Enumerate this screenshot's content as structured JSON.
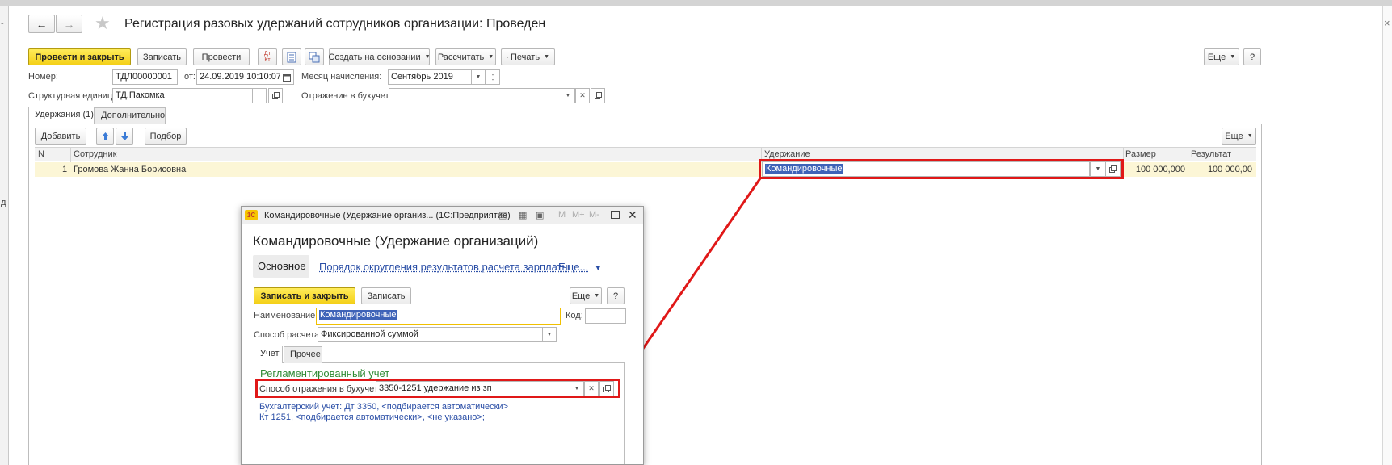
{
  "window": {
    "title": "Регистрация разовых удержаний сотрудников организации: Проведен",
    "close_glyph": "×",
    "back_glyph": "←",
    "forward_glyph": "→",
    "star_glyph": "★"
  },
  "left_panel": {
    "chars": [
      "-",
      "д"
    ]
  },
  "toolbar": {
    "post_close": "Провести и закрыть",
    "save": "Записать",
    "post": "Провести",
    "dtkt": "Дт Кт",
    "create_based": "Создать на основании",
    "calculate": "Рассчитать",
    "print": "Печать",
    "more": "Еще",
    "help": "?"
  },
  "fields": {
    "number_label": "Номер:",
    "number_value": "ТДЛ00000001",
    "date_label": "от:",
    "date_value": "24.09.2019 10:10:07",
    "month_label": "Месяц начисления:",
    "month_value": "Сентябрь 2019",
    "unit_label": "Структурная единица:",
    "unit_value": "ТД.Пакомка",
    "accounting_label": "Отражение в бухучете:",
    "accounting_value": ""
  },
  "tabs": [
    {
      "label": "Удержания (1)"
    },
    {
      "label": "Дополнительно"
    }
  ],
  "table_toolbar": {
    "add": "Добавить",
    "select": "Подбор",
    "more": "Еще"
  },
  "table": {
    "columns": [
      "N",
      "Сотрудник",
      "Удержание",
      "Размер",
      "Результат"
    ],
    "rows": [
      {
        "n": "1",
        "employee": "Громова Жанна Борисовна",
        "deduction": "Командировочные",
        "size": "100 000,000",
        "result": "100 000,00"
      }
    ]
  },
  "dialog": {
    "title": "Командировочные (Удержание организ... (1С:Предприятие)",
    "logo": "1С",
    "title_icons": [
      "M",
      "M+",
      "M-"
    ],
    "heading": "Командировочные (Удержание организаций)",
    "nav_main": "Основное",
    "nav_rounding": "Порядок округления результатов расчета зарплаты",
    "nav_more": "Еще...",
    "save_close": "Записать и закрыть",
    "save": "Записать",
    "more": "Еще",
    "help": "?",
    "name_label": "Наименование:",
    "name_value": "Командировочные",
    "code_label": "Код:",
    "code_value": "",
    "calc_label": "Способ расчета:",
    "calc_value": "Фиксированной суммой",
    "tabs": [
      {
        "label": "Учет"
      },
      {
        "label": "Прочее"
      }
    ],
    "group_title": "Регламентированный учет",
    "reflect_label": "Способ отражения в бухучете:",
    "reflect_value": "3350-1251 удержание из зп",
    "info_line1": "Бухгалтерский учет: Дт 3350, <подбирается автоматически>",
    "info_line2": "Кт 1251, <подбирается автоматически>, <не указано>;"
  },
  "colors": {
    "accent_yellow": "#f4d018",
    "selection_blue": "#3e63b8",
    "highlight_red": "#e01818",
    "row_highlight": "#fcf6d6",
    "group_green": "#2f8b34",
    "link_blue": "#2a4ea6"
  }
}
